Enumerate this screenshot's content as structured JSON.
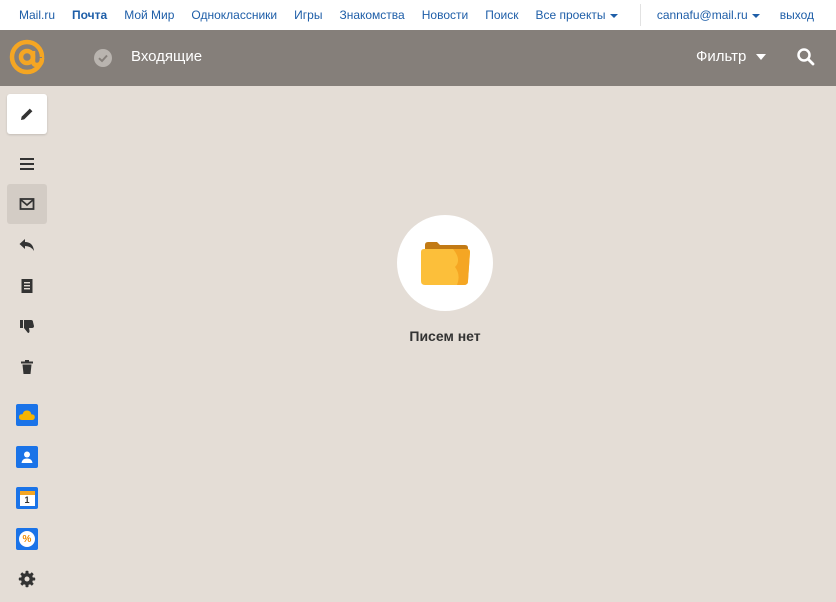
{
  "portal": {
    "links": [
      {
        "label": "Mail.ru"
      },
      {
        "label": "Почта",
        "active": true
      },
      {
        "label": "Мой Мир"
      },
      {
        "label": "Одноклассники"
      },
      {
        "label": "Игры"
      },
      {
        "label": "Знакомства"
      },
      {
        "label": "Новости"
      },
      {
        "label": "Поиск"
      },
      {
        "label": "Все проекты"
      }
    ],
    "user_email": "cannafu@mail.ru",
    "logout": "выход"
  },
  "header": {
    "title": "Входящие",
    "filter_label": "Фильтр"
  },
  "sidebar": {
    "items": [
      {
        "name": "compose",
        "icon": "pencil-icon"
      },
      {
        "name": "menu",
        "icon": "hamburger-icon"
      },
      {
        "name": "inbox",
        "icon": "envelope-icon",
        "selected": true
      },
      {
        "name": "sent",
        "icon": "reply-icon"
      },
      {
        "name": "drafts",
        "icon": "document-icon"
      },
      {
        "name": "spam",
        "icon": "thumbs-down-icon"
      },
      {
        "name": "trash",
        "icon": "trash-icon"
      },
      {
        "name": "cloud",
        "icon": "cloud-icon"
      },
      {
        "name": "contacts",
        "icon": "contacts-icon"
      },
      {
        "name": "calendar",
        "icon": "calendar-icon",
        "calendar_day": "1"
      },
      {
        "name": "promo",
        "icon": "percent-icon",
        "promo_symbol": "%"
      },
      {
        "name": "settings",
        "icon": "gear-icon"
      }
    ]
  },
  "main": {
    "empty_text": "Писем нет",
    "empty_icon": "folder-icon"
  },
  "colors": {
    "header_bg": "#857f7a",
    "page_bg": "#e4ddd6",
    "link": "#1e5ea8",
    "logo_orange": "#f5a623"
  }
}
